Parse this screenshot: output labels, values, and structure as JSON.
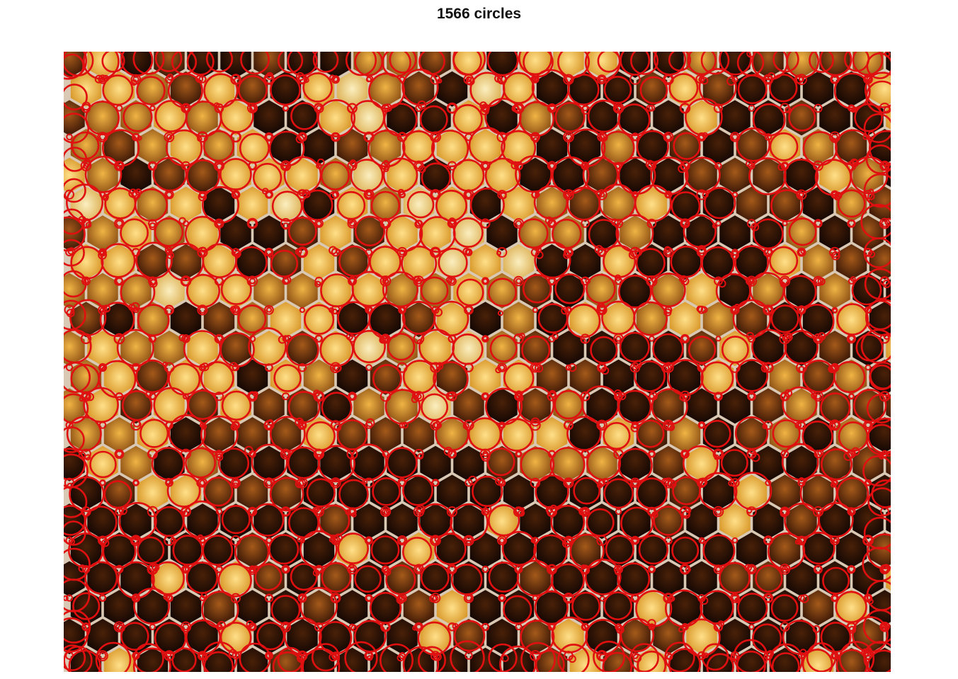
{
  "figure": {
    "title": "1566 circles"
  },
  "image": {
    "subject": "honeycomb-photo",
    "colors": {
      "comb_wall": "#d9c8b4",
      "cell_dark": "#1c0c05",
      "cell_brown": "#6a3510",
      "cell_amber": "#c98a2a",
      "pollen_yellow": "#f3c24c",
      "pollen_pale": "#f6dd90",
      "circle_stroke": "#e01010"
    }
  }
}
